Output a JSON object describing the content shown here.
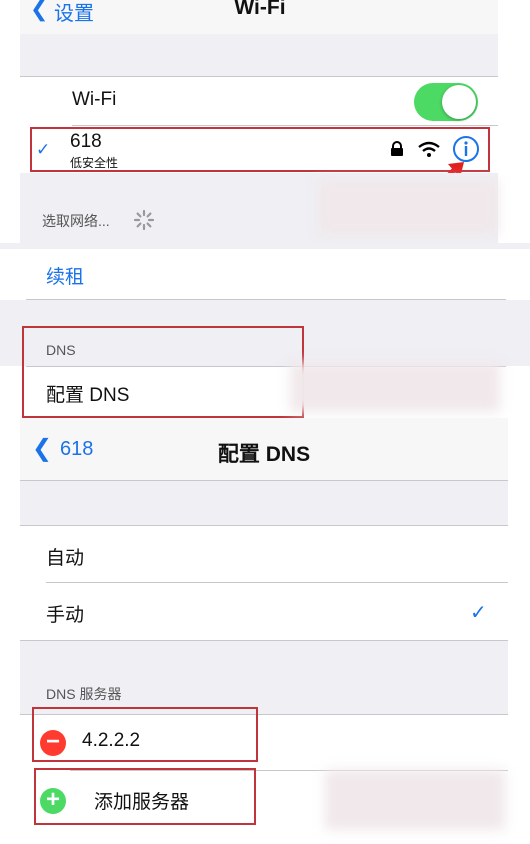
{
  "top_nav": {
    "back_label": "设置",
    "title": "Wi-Fi"
  },
  "wifi": {
    "toggle_label": "Wi-Fi",
    "toggle_on": true
  },
  "network": {
    "name": "618",
    "subtitle": "低安全性",
    "checked": true
  },
  "choose_network": {
    "label": "选取网络..."
  },
  "lease": {
    "renew_label": "续租"
  },
  "dns_section": {
    "header": "DNS",
    "configure_label": "配置 DNS"
  },
  "dns_nav": {
    "back_label": "618",
    "title": "配置 DNS"
  },
  "dns_mode": {
    "options": [
      "自动",
      "手动"
    ],
    "selected": "手动"
  },
  "dns_servers": {
    "header": "DNS 服务器",
    "servers": [
      "4.2.2.2"
    ],
    "add_label": "添加服务器"
  },
  "colors": {
    "accent": "#1a73e8",
    "toggle_on": "#4cd964",
    "delete": "#ff3b30",
    "add": "#4cd964",
    "highlight_box": "#c0343c"
  }
}
